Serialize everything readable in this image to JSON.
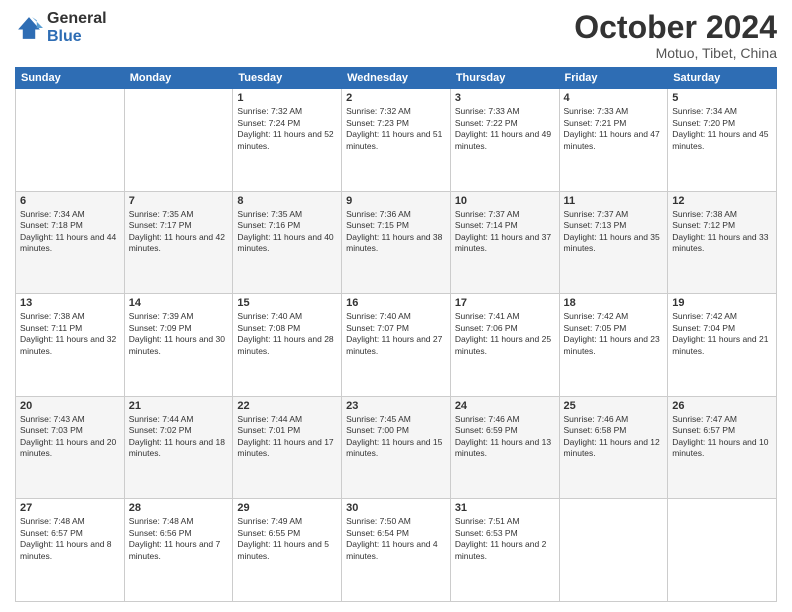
{
  "header": {
    "logo_general": "General",
    "logo_blue": "Blue",
    "month_title": "October 2024",
    "location": "Motuo, Tibet, China"
  },
  "weekdays": [
    "Sunday",
    "Monday",
    "Tuesday",
    "Wednesday",
    "Thursday",
    "Friday",
    "Saturday"
  ],
  "weeks": [
    [
      {
        "day": "",
        "sunrise": "",
        "sunset": "",
        "daylight": ""
      },
      {
        "day": "",
        "sunrise": "",
        "sunset": "",
        "daylight": ""
      },
      {
        "day": "1",
        "sunrise": "Sunrise: 7:32 AM",
        "sunset": "Sunset: 7:24 PM",
        "daylight": "Daylight: 11 hours and 52 minutes."
      },
      {
        "day": "2",
        "sunrise": "Sunrise: 7:32 AM",
        "sunset": "Sunset: 7:23 PM",
        "daylight": "Daylight: 11 hours and 51 minutes."
      },
      {
        "day": "3",
        "sunrise": "Sunrise: 7:33 AM",
        "sunset": "Sunset: 7:22 PM",
        "daylight": "Daylight: 11 hours and 49 minutes."
      },
      {
        "day": "4",
        "sunrise": "Sunrise: 7:33 AM",
        "sunset": "Sunset: 7:21 PM",
        "daylight": "Daylight: 11 hours and 47 minutes."
      },
      {
        "day": "5",
        "sunrise": "Sunrise: 7:34 AM",
        "sunset": "Sunset: 7:20 PM",
        "daylight": "Daylight: 11 hours and 45 minutes."
      }
    ],
    [
      {
        "day": "6",
        "sunrise": "Sunrise: 7:34 AM",
        "sunset": "Sunset: 7:18 PM",
        "daylight": "Daylight: 11 hours and 44 minutes."
      },
      {
        "day": "7",
        "sunrise": "Sunrise: 7:35 AM",
        "sunset": "Sunset: 7:17 PM",
        "daylight": "Daylight: 11 hours and 42 minutes."
      },
      {
        "day": "8",
        "sunrise": "Sunrise: 7:35 AM",
        "sunset": "Sunset: 7:16 PM",
        "daylight": "Daylight: 11 hours and 40 minutes."
      },
      {
        "day": "9",
        "sunrise": "Sunrise: 7:36 AM",
        "sunset": "Sunset: 7:15 PM",
        "daylight": "Daylight: 11 hours and 38 minutes."
      },
      {
        "day": "10",
        "sunrise": "Sunrise: 7:37 AM",
        "sunset": "Sunset: 7:14 PM",
        "daylight": "Daylight: 11 hours and 37 minutes."
      },
      {
        "day": "11",
        "sunrise": "Sunrise: 7:37 AM",
        "sunset": "Sunset: 7:13 PM",
        "daylight": "Daylight: 11 hours and 35 minutes."
      },
      {
        "day": "12",
        "sunrise": "Sunrise: 7:38 AM",
        "sunset": "Sunset: 7:12 PM",
        "daylight": "Daylight: 11 hours and 33 minutes."
      }
    ],
    [
      {
        "day": "13",
        "sunrise": "Sunrise: 7:38 AM",
        "sunset": "Sunset: 7:11 PM",
        "daylight": "Daylight: 11 hours and 32 minutes."
      },
      {
        "day": "14",
        "sunrise": "Sunrise: 7:39 AM",
        "sunset": "Sunset: 7:09 PM",
        "daylight": "Daylight: 11 hours and 30 minutes."
      },
      {
        "day": "15",
        "sunrise": "Sunrise: 7:40 AM",
        "sunset": "Sunset: 7:08 PM",
        "daylight": "Daylight: 11 hours and 28 minutes."
      },
      {
        "day": "16",
        "sunrise": "Sunrise: 7:40 AM",
        "sunset": "Sunset: 7:07 PM",
        "daylight": "Daylight: 11 hours and 27 minutes."
      },
      {
        "day": "17",
        "sunrise": "Sunrise: 7:41 AM",
        "sunset": "Sunset: 7:06 PM",
        "daylight": "Daylight: 11 hours and 25 minutes."
      },
      {
        "day": "18",
        "sunrise": "Sunrise: 7:42 AM",
        "sunset": "Sunset: 7:05 PM",
        "daylight": "Daylight: 11 hours and 23 minutes."
      },
      {
        "day": "19",
        "sunrise": "Sunrise: 7:42 AM",
        "sunset": "Sunset: 7:04 PM",
        "daylight": "Daylight: 11 hours and 21 minutes."
      }
    ],
    [
      {
        "day": "20",
        "sunrise": "Sunrise: 7:43 AM",
        "sunset": "Sunset: 7:03 PM",
        "daylight": "Daylight: 11 hours and 20 minutes."
      },
      {
        "day": "21",
        "sunrise": "Sunrise: 7:44 AM",
        "sunset": "Sunset: 7:02 PM",
        "daylight": "Daylight: 11 hours and 18 minutes."
      },
      {
        "day": "22",
        "sunrise": "Sunrise: 7:44 AM",
        "sunset": "Sunset: 7:01 PM",
        "daylight": "Daylight: 11 hours and 17 minutes."
      },
      {
        "day": "23",
        "sunrise": "Sunrise: 7:45 AM",
        "sunset": "Sunset: 7:00 PM",
        "daylight": "Daylight: 11 hours and 15 minutes."
      },
      {
        "day": "24",
        "sunrise": "Sunrise: 7:46 AM",
        "sunset": "Sunset: 6:59 PM",
        "daylight": "Daylight: 11 hours and 13 minutes."
      },
      {
        "day": "25",
        "sunrise": "Sunrise: 7:46 AM",
        "sunset": "Sunset: 6:58 PM",
        "daylight": "Daylight: 11 hours and 12 minutes."
      },
      {
        "day": "26",
        "sunrise": "Sunrise: 7:47 AM",
        "sunset": "Sunset: 6:57 PM",
        "daylight": "Daylight: 11 hours and 10 minutes."
      }
    ],
    [
      {
        "day": "27",
        "sunrise": "Sunrise: 7:48 AM",
        "sunset": "Sunset: 6:57 PM",
        "daylight": "Daylight: 11 hours and 8 minutes."
      },
      {
        "day": "28",
        "sunrise": "Sunrise: 7:48 AM",
        "sunset": "Sunset: 6:56 PM",
        "daylight": "Daylight: 11 hours and 7 minutes."
      },
      {
        "day": "29",
        "sunrise": "Sunrise: 7:49 AM",
        "sunset": "Sunset: 6:55 PM",
        "daylight": "Daylight: 11 hours and 5 minutes."
      },
      {
        "day": "30",
        "sunrise": "Sunrise: 7:50 AM",
        "sunset": "Sunset: 6:54 PM",
        "daylight": "Daylight: 11 hours and 4 minutes."
      },
      {
        "day": "31",
        "sunrise": "Sunrise: 7:51 AM",
        "sunset": "Sunset: 6:53 PM",
        "daylight": "Daylight: 11 hours and 2 minutes."
      },
      {
        "day": "",
        "sunrise": "",
        "sunset": "",
        "daylight": ""
      },
      {
        "day": "",
        "sunrise": "",
        "sunset": "",
        "daylight": ""
      }
    ]
  ]
}
